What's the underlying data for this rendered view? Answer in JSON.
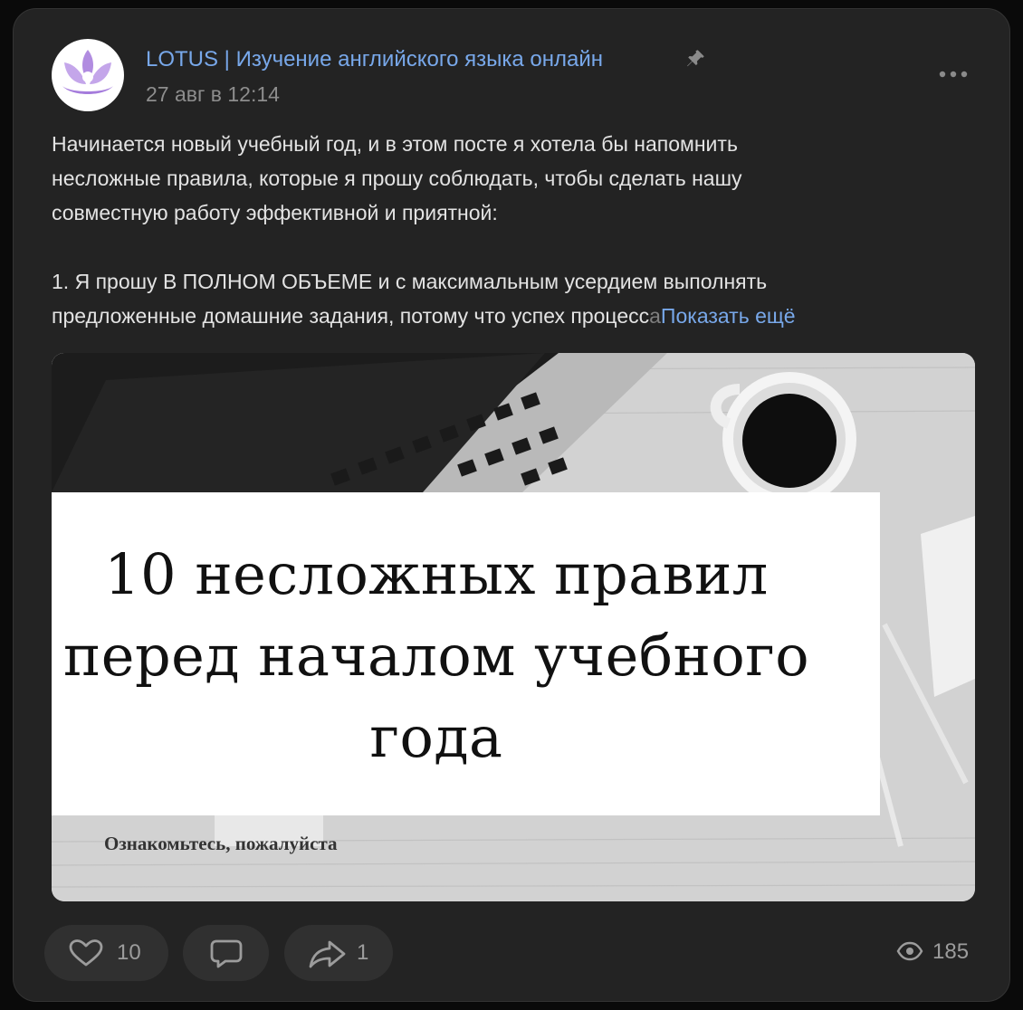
{
  "post": {
    "author": "LOTUS | Изучение английского языка онлайн",
    "date": "27 авг в 12:14",
    "text": {
      "line1": "Начинается новый учебный год, и в этом посте я хотела бы напомнить",
      "line2": "несложные правила, которые я прошу соблюдать, чтобы сделать нашу",
      "line3": "совместную работу эффективной и приятной:",
      "line4": "1. Я прошу В ПОЛНОМ ОБЪЕМЕ и с максимальным усердием выполнять",
      "line5_main": "предложенные домашние задания, потому что успех процесс",
      "line5_fade": "а",
      "show_more": "Показать ещё"
    },
    "image": {
      "title_line1": "10 несложных правил",
      "title_line2": "перед началом учебного",
      "title_line3": "года",
      "subtitle": "Ознакомьтесь, пожалуйста"
    }
  },
  "actions": {
    "likes": "10",
    "shares": "1",
    "views": "185"
  },
  "colors": {
    "card": "#232323",
    "link": "#78a8ea",
    "text": "#e3e3e3",
    "muted": "#8d8d8d",
    "button": "#303030",
    "avatar_accent": "#b18ce0"
  },
  "icons": [
    "avatar-lotus-logo",
    "pin-icon",
    "more-icon",
    "heart-icon",
    "comment-icon",
    "share-icon",
    "eye-icon"
  ]
}
